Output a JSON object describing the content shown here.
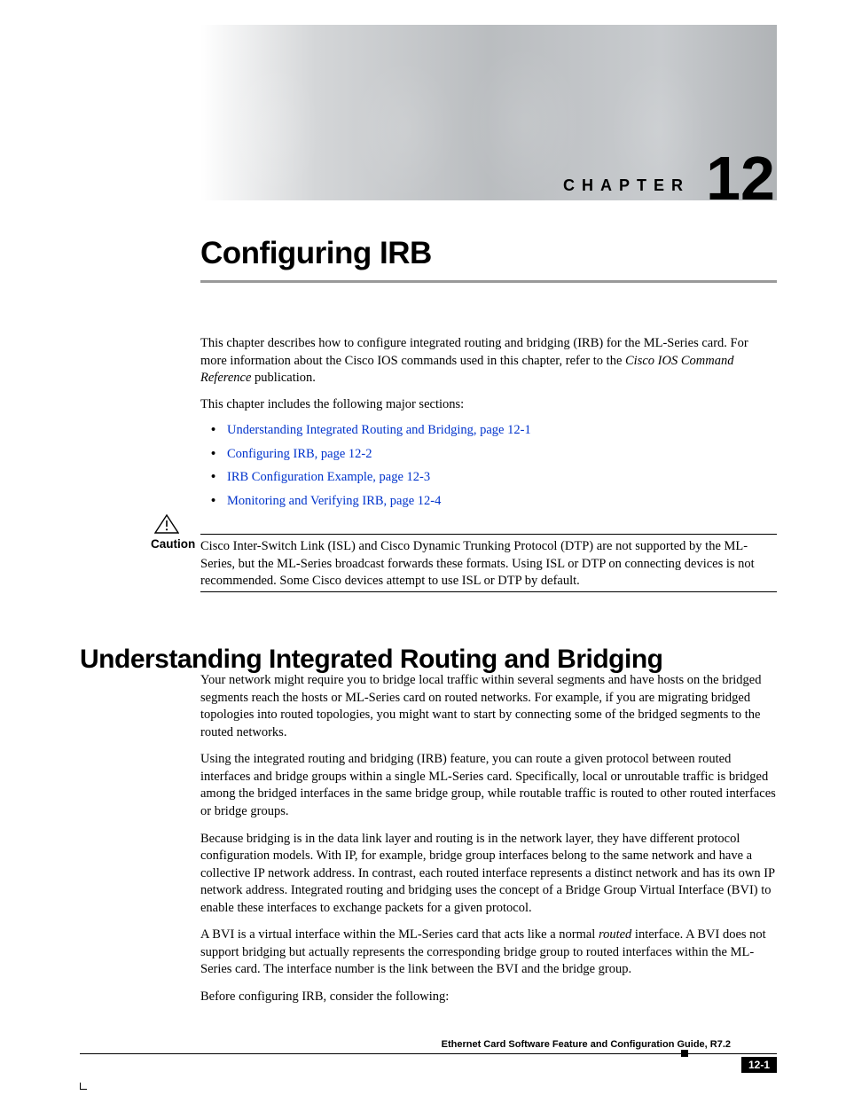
{
  "chapter": {
    "label": "CHAPTER",
    "number": "12"
  },
  "title": "Configuring IRB",
  "intro": {
    "p1a": "This chapter describes how to configure integrated routing and bridging (IRB) for the ML-Series card. For more information about the Cisco IOS commands used in this chapter, refer to the ",
    "p1_italic": "Cisco IOS Command Reference",
    "p1b": " publication.",
    "p2": "This chapter includes the following major sections:"
  },
  "toc": [
    "Understanding Integrated Routing and Bridging, page 12-1",
    "Configuring IRB, page 12-2",
    "IRB Configuration Example, page 12-3",
    "Monitoring and Verifying IRB, page 12-4"
  ],
  "caution": {
    "label": "Caution",
    "text": "Cisco Inter-Switch Link (ISL) and Cisco Dynamic Trunking Protocol (DTP) are not supported by the ML-Series, but the ML-Series broadcast forwards these formats. Using ISL or DTP on connecting devices is not recommended. Some Cisco devices attempt to use ISL or DTP by default."
  },
  "section1": {
    "heading": "Understanding Integrated Routing and Bridging",
    "p1": "Your network might require you to bridge local traffic within several segments and have hosts on the bridged segments reach the hosts or ML-Series card on routed networks. For example, if you are migrating bridged topologies into routed topologies, you might want to start by connecting some of the bridged segments to the routed networks.",
    "p2": "Using the integrated routing and bridging (IRB) feature, you can route a given protocol between routed interfaces and bridge groups within a single ML-Series card. Specifically, local or unroutable traffic is bridged among the bridged interfaces in the same bridge group, while routable traffic is routed to other routed interfaces or bridge groups.",
    "p3": "Because bridging is in the data link layer and routing is in the network layer, they have different protocol configuration models. With IP, for example, bridge group interfaces belong to the same network and have a collective IP network address. In contrast, each routed interface represents a distinct network and has its own IP network address. Integrated routing and bridging uses the concept of a Bridge Group Virtual Interface (BVI) to enable these interfaces to exchange packets for a given protocol.",
    "p4a": "A BVI is a virtual interface within the ML-Series card that acts like a normal ",
    "p4_italic": "routed",
    "p4b": " interface. A BVI does not support bridging but actually represents the corresponding bridge group to routed interfaces within the ML-Series card. The interface number is the link between the BVI and the bridge group.",
    "p5": "Before configuring IRB, consider the following:"
  },
  "footer": {
    "guide_title": "Ethernet Card Software Feature and Configuration Guide, R7.2",
    "page_number": "12-1"
  }
}
